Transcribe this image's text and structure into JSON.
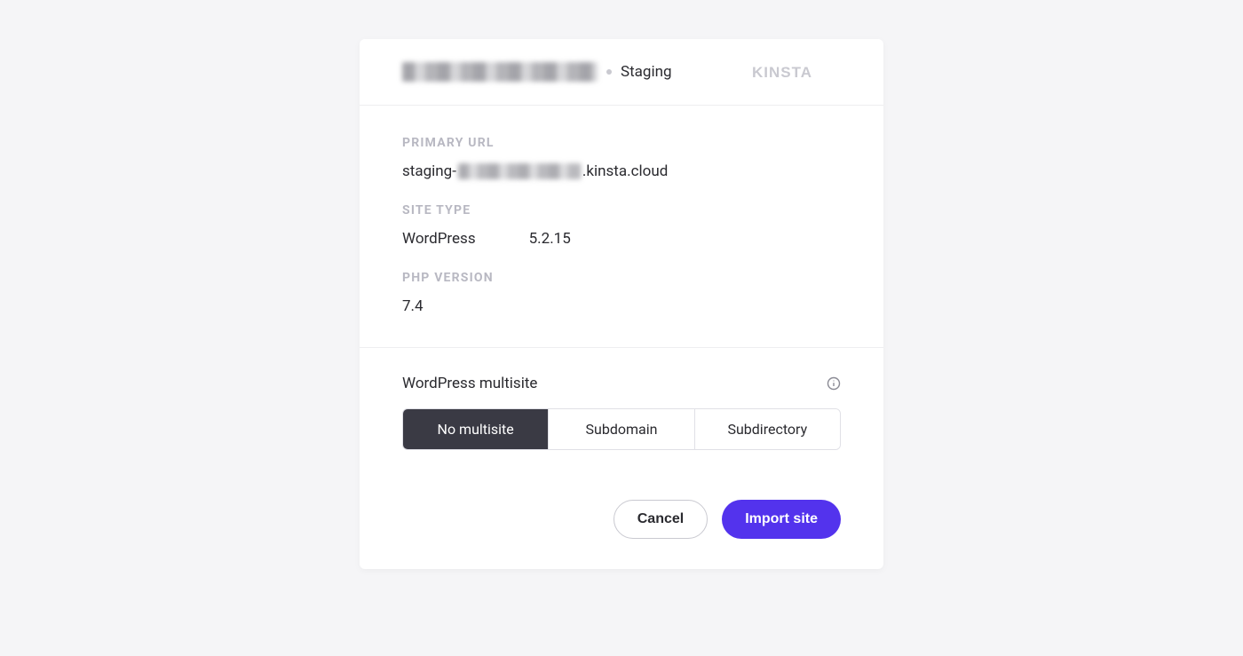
{
  "header": {
    "env_label": "Staging",
    "logo_name": "kinsta"
  },
  "sections": {
    "primary_url": {
      "label": "PRIMARY URL",
      "prefix": "staging-",
      "suffix": ".kinsta.cloud"
    },
    "site_type": {
      "label": "SITE TYPE",
      "platform": "WordPress",
      "version": "5.2.15"
    },
    "php_version": {
      "label": "PHP VERSION",
      "value": "7.4"
    }
  },
  "multisite": {
    "title": "WordPress multisite",
    "options": {
      "no_multisite": "No multisite",
      "subdomain": "Subdomain",
      "subdirectory": "Subdirectory"
    },
    "selected": "no_multisite"
  },
  "actions": {
    "cancel": "Cancel",
    "import": "Import site"
  }
}
